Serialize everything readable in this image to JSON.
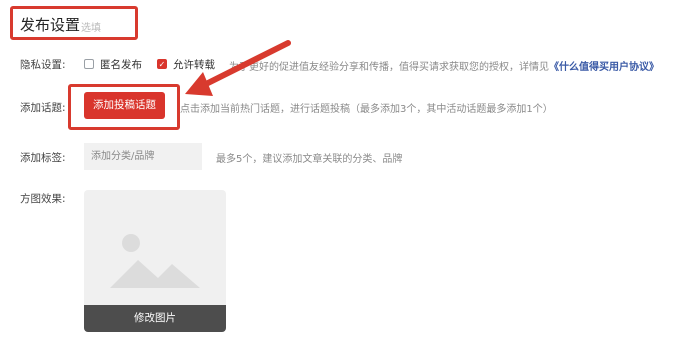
{
  "section": {
    "title": "发布设置",
    "optional_tag": "选填"
  },
  "privacy": {
    "label": "隐私设置:",
    "anonymous": {
      "label": "匿名发布",
      "checked": false
    },
    "allow_repost": {
      "label": "允许转载",
      "checked": true
    },
    "hint_prefix": "为了更好的促进值友经验分享和传播，值得买请求获取您的授权，详情见",
    "hint_link": "《什么值得买用户协议》"
  },
  "topic": {
    "label": "添加话题:",
    "button_label": "添加投稿话题",
    "hint": "点击添加当前热门话题，进行话题投稿（最多添加3个，其中活动话题最多添加1个）"
  },
  "tags": {
    "label": "添加标签:",
    "placeholder": "添加分类/品牌",
    "hint": "最多5个，建议添加文章关联的分类、品牌"
  },
  "cover": {
    "label": "方图效果:",
    "edit_label": "修改图片"
  },
  "colors": {
    "accent": "#d9352c",
    "link": "#3a5aa6",
    "annotation": "#d83a2e"
  },
  "icons": {
    "image_placeholder": "image-placeholder-icon",
    "check": "check-icon",
    "arrow": "annotation-arrow"
  }
}
